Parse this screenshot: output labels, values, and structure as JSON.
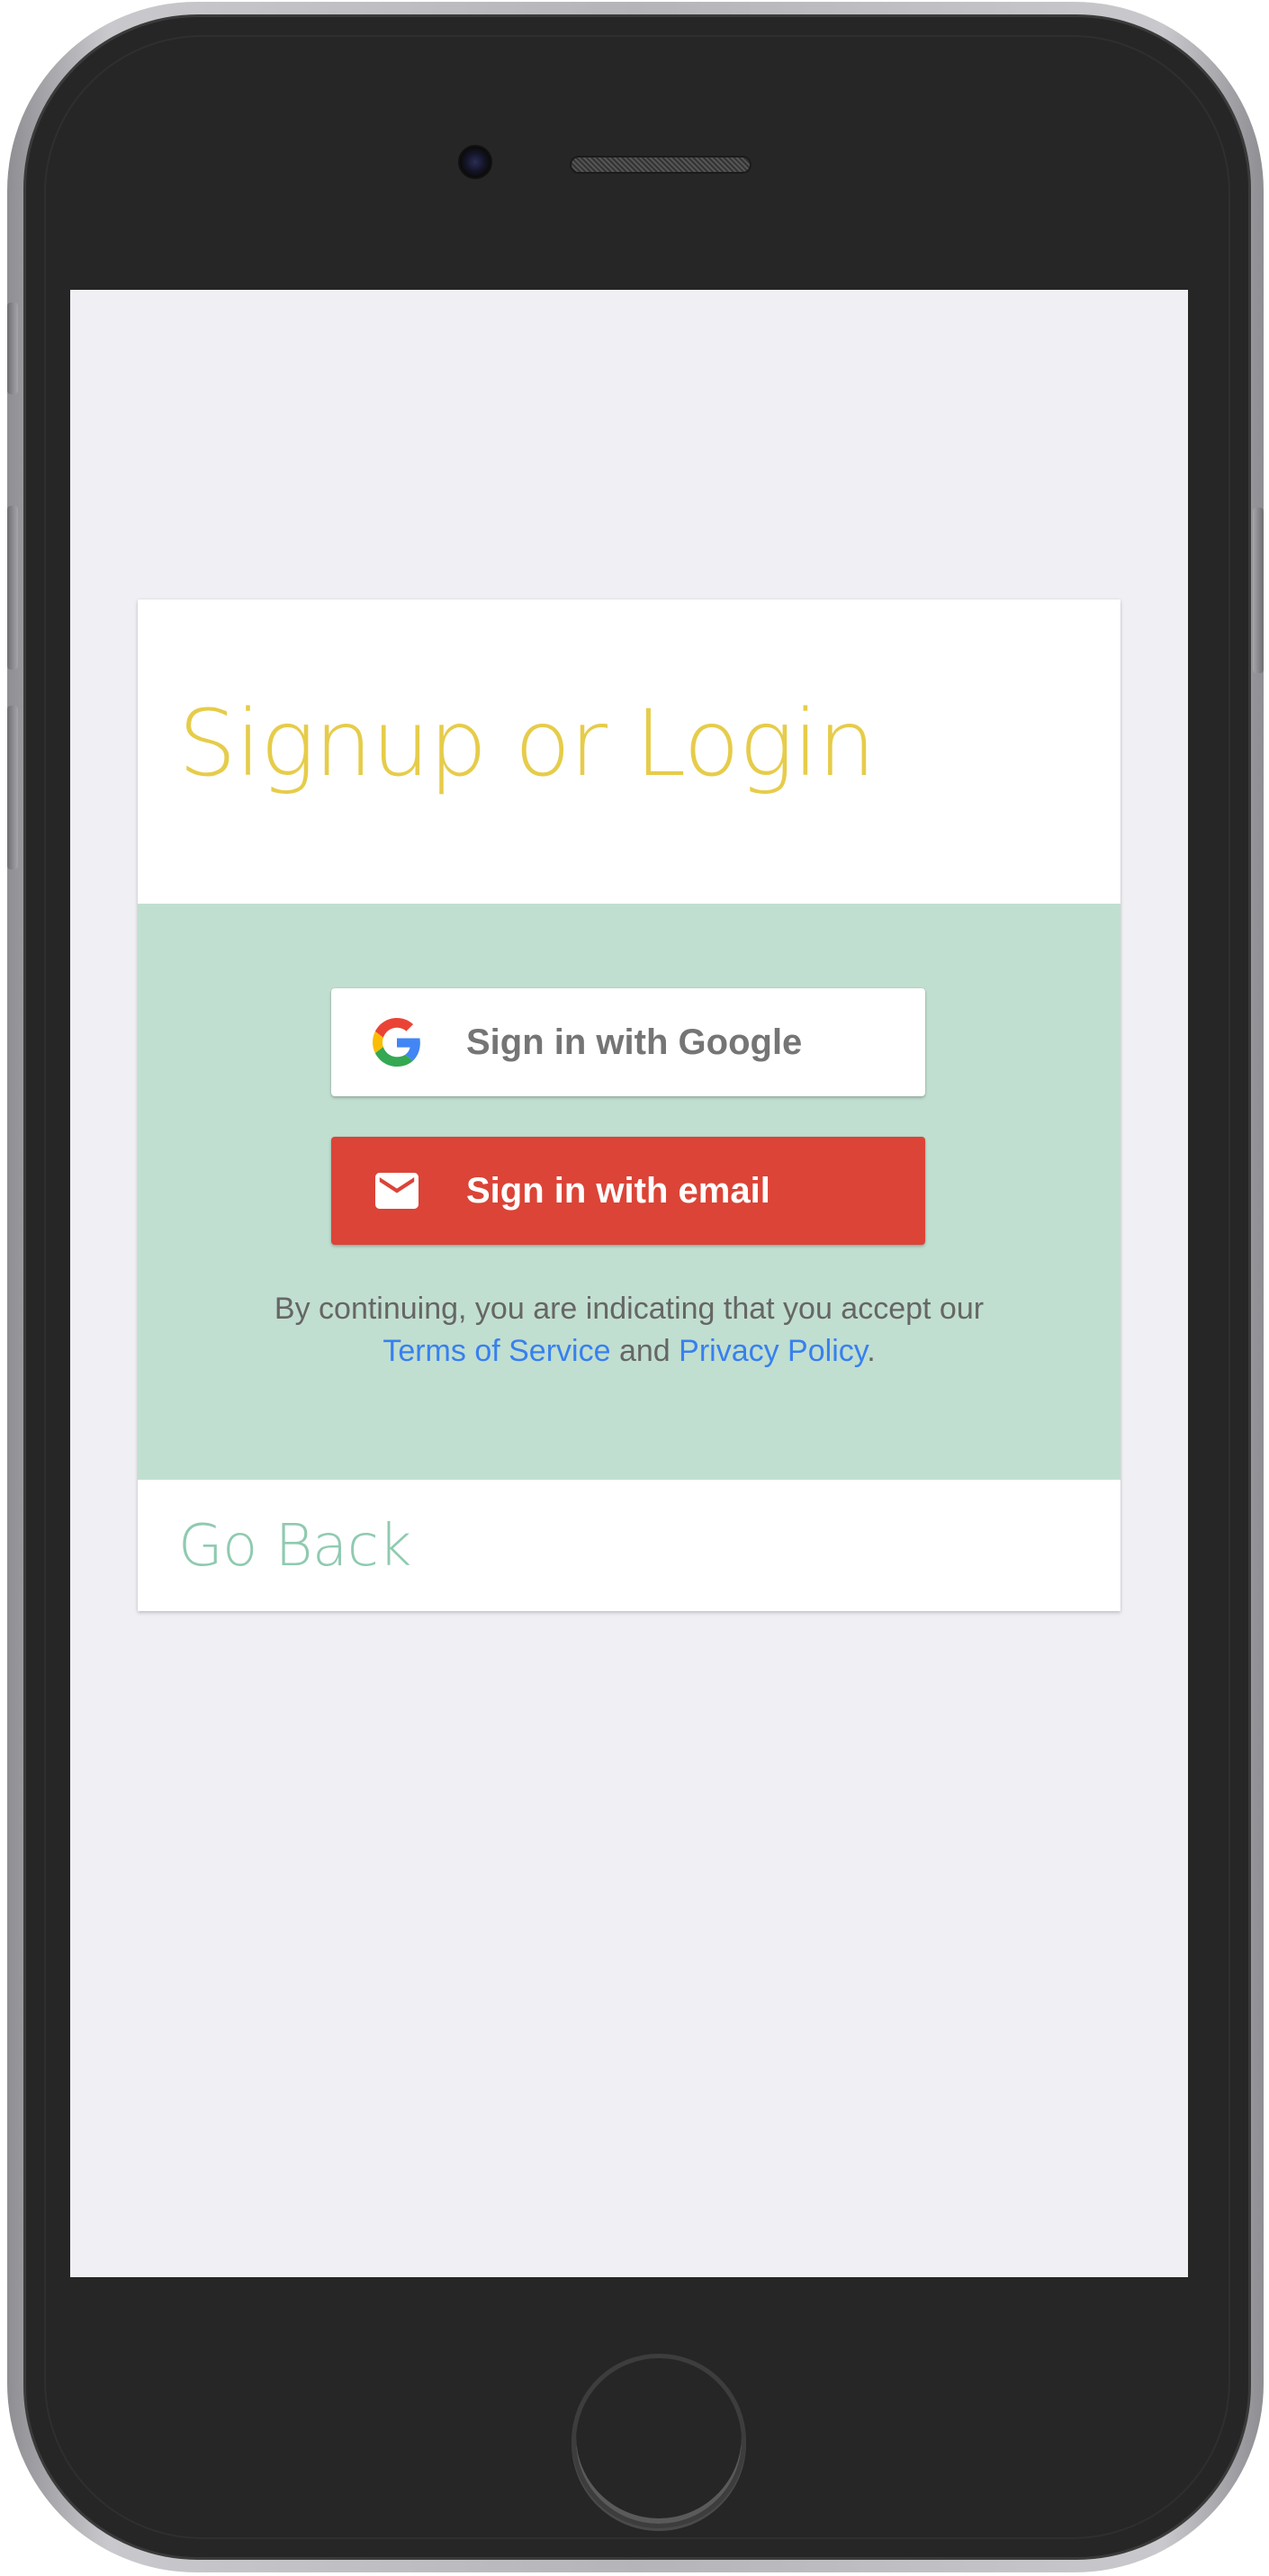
{
  "auth": {
    "title": "Signup or Login",
    "google_button": {
      "label": "Sign in with Google",
      "icon": "google-g-icon"
    },
    "email_button": {
      "label": "Sign in with email",
      "icon": "envelope-icon"
    },
    "tos": {
      "prefix": "By continuing, you are indicating that you accept our",
      "terms_link": "Terms of Service",
      "connector": "and",
      "privacy_link": "Privacy Policy",
      "suffix": "."
    },
    "go_back": "Go Back"
  },
  "colors": {
    "title": "#e6cc4a",
    "panel_background": "#c1dfd0",
    "email_button": "#db4437",
    "link": "#3880ef",
    "go_back": "#8fcab0",
    "screen_background": "#efeff4"
  }
}
